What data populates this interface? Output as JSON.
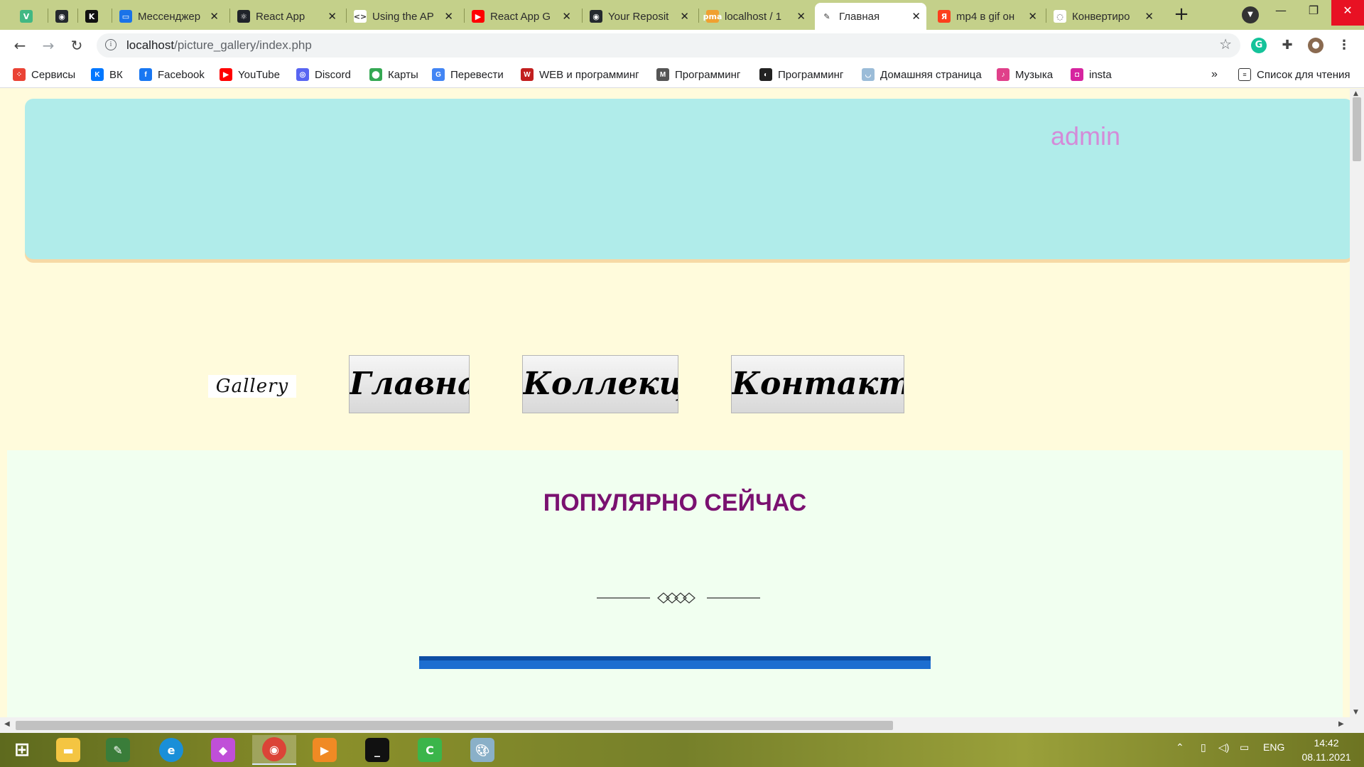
{
  "browser": {
    "tabs": [
      {
        "title": "",
        "icon": "vue-icon",
        "color": "#41b883",
        "glyph": "V"
      },
      {
        "title": "",
        "icon": "github-icon",
        "color": "#24292e",
        "glyph": "◉"
      },
      {
        "title": "",
        "icon": "k-icon",
        "color": "#111111",
        "glyph": "K"
      },
      {
        "title": "Мессенджер",
        "icon": "messenger-icon",
        "color": "#1a73e8",
        "glyph": "▭"
      },
      {
        "title": "React App",
        "icon": "react-icon",
        "color": "#20232a",
        "glyph": "⚛"
      },
      {
        "title": "Using the AP",
        "icon": "code-icon",
        "color": "#ffffff",
        "glyph": "<>"
      },
      {
        "title": "React App G",
        "icon": "youtube-icon",
        "color": "#ff0000",
        "glyph": "▶"
      },
      {
        "title": "Your Reposit",
        "icon": "github-icon",
        "color": "#24292e",
        "glyph": "◉"
      },
      {
        "title": "localhost / 1",
        "icon": "phpmyadmin-icon",
        "color": "#f0a030",
        "glyph": "pma"
      },
      {
        "title": "Главная",
        "icon": "feather-icon",
        "color": "#ffffff",
        "glyph": "✎"
      },
      {
        "title": "mp4 в gif он",
        "icon": "yandex-icon",
        "color": "#fc3f1d",
        "glyph": "Я"
      },
      {
        "title": "Конвертиро",
        "icon": "loading-icon",
        "color": "#ffffff",
        "glyph": "◌"
      }
    ],
    "url_host": "localhost",
    "url_path": "/picture_gallery/index.php",
    "bookmarks": [
      {
        "label": "Сервисы",
        "icon": "apps-grid-icon",
        "color": "#ea4335",
        "glyph": "⁘"
      },
      {
        "label": "ВК",
        "icon": "vk-icon",
        "color": "#0077ff",
        "glyph": "K"
      },
      {
        "label": "Facebook",
        "icon": "facebook-icon",
        "color": "#1877f2",
        "glyph": "f"
      },
      {
        "label": "YouTube",
        "icon": "youtube-icon",
        "color": "#ff0000",
        "glyph": "▶"
      },
      {
        "label": "Discord",
        "icon": "discord-icon",
        "color": "#5865f2",
        "glyph": "◎"
      },
      {
        "label": "Карты",
        "icon": "maps-pin-icon",
        "color": "#34a853",
        "glyph": "⬤"
      },
      {
        "label": "Перевести",
        "icon": "translate-icon",
        "color": "#4285f4",
        "glyph": "G"
      },
      {
        "label": "WEB и программинг",
        "icon": "web-icon",
        "color": "#c21f1f",
        "glyph": "W"
      },
      {
        "label": "Программинг",
        "icon": "gmail-icon",
        "color": "#555555",
        "glyph": "M"
      },
      {
        "label": "Программинг",
        "icon": "globe-icon",
        "color": "#222222",
        "glyph": "◐"
      },
      {
        "label": "Домашняя страница",
        "icon": "home-page-icon",
        "color": "#9bbcd8",
        "glyph": "◡"
      },
      {
        "label": "Музыка",
        "icon": "music-icon",
        "color": "#e0408a",
        "glyph": "♪"
      },
      {
        "label": "insta",
        "icon": "instagram-icon",
        "color": "#d6249f",
        "glyph": "◘"
      }
    ],
    "overflow": "»",
    "reading_list": "Список для чтения"
  },
  "page": {
    "admin_label": "admin",
    "logo": "Gallery",
    "nav": [
      "Главная",
      "Коллекция",
      "Контакты"
    ],
    "popular_title": "ПОПУЛЯРНО СЕЙЧАС"
  },
  "taskbar": {
    "lang": "ENG",
    "time": "14:42",
    "date": "08.11.2021"
  },
  "colors": {
    "page_bg": "#fffbdc",
    "header_bg": "#b0ecea",
    "admin": "#d48bd8",
    "popular_bg": "#f1fff0",
    "popular_title": "#7a1170",
    "blue_bar": "#1c6ed0"
  }
}
